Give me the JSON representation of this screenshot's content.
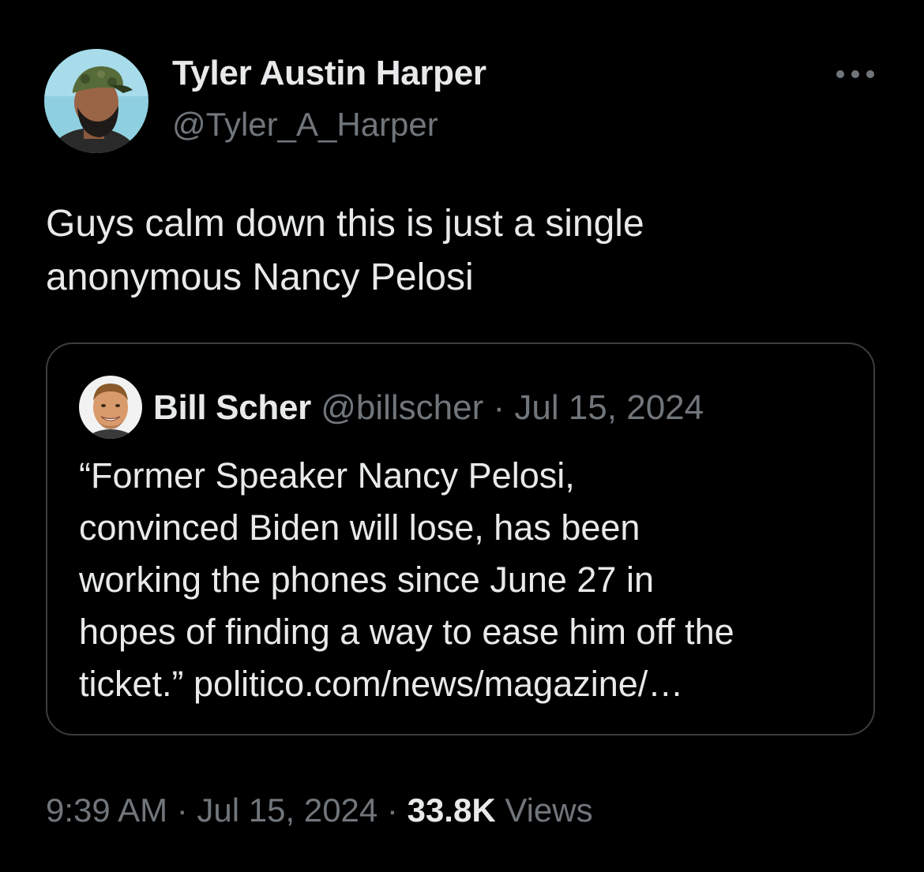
{
  "tweet": {
    "author": {
      "name": "Tyler Austin Harper",
      "handle": "@Tyler_A_Harper",
      "avatar_icon": "user-avatar-photo"
    },
    "more_icon": "more-options-icon",
    "text": "Guys calm down this is just a single\nanonymous Nancy Pelosi",
    "quote": {
      "author_name": "Bill Scher",
      "meta": "@billscher · Jul 15, 2024",
      "avatar_icon": "user-avatar-photo",
      "text": "“Former Speaker Nancy Pelosi,\nconvinced Biden will lose, has been\nworking the phones since June 27 in\nhopes of finding a way to ease him off the\nticket.” politico.com/news/magazine/…"
    },
    "footer": {
      "timestamp": "9:39 AM · Jul 15, 2024 · ",
      "views_count": "33.8K",
      "views_label": " Views"
    }
  },
  "colors": {
    "background": "#000000",
    "primary_text": "#e7e9ea",
    "secondary_text": "#71767b",
    "border": "#3a3d40"
  }
}
